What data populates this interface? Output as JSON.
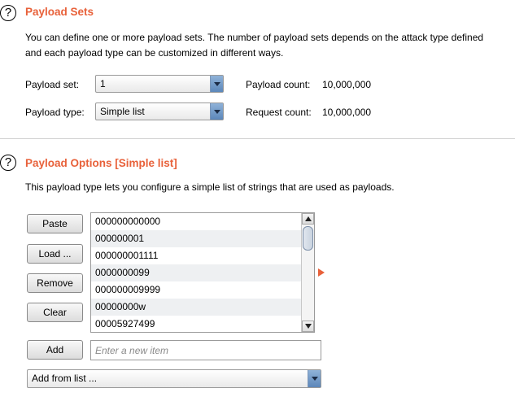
{
  "payload_sets": {
    "help_glyph": "?",
    "title": "Payload Sets",
    "description_line1": "You can define one or more payload sets. The number of payload sets depends on the attack type defined",
    "description_line2": "and each payload type can be customized in different ways.",
    "set_label": "Payload set:",
    "set_value": "1",
    "type_label": "Payload type:",
    "type_value": "Simple list",
    "payload_count_label": "Payload count:",
    "payload_count_value": "10,000,000",
    "request_count_label": "Request count:",
    "request_count_value": "10,000,000"
  },
  "payload_options": {
    "help_glyph": "?",
    "title": "Payload Options [Simple list]",
    "description": "This payload type lets you configure a simple list of strings that are used as payloads.",
    "buttons": {
      "paste": "Paste",
      "load": "Load ...",
      "remove": "Remove",
      "clear": "Clear",
      "add": "Add"
    },
    "list_items": [
      "000000000000",
      "000000001",
      "000000001111",
      "0000000099",
      "000000009999",
      "00000000w",
      "00005927499"
    ],
    "new_item_placeholder": "Enter a new item",
    "add_from_list_label": "Add from list ..."
  },
  "colors": {
    "accent": "#e8613a",
    "select_arrow": "#5c87ba"
  }
}
